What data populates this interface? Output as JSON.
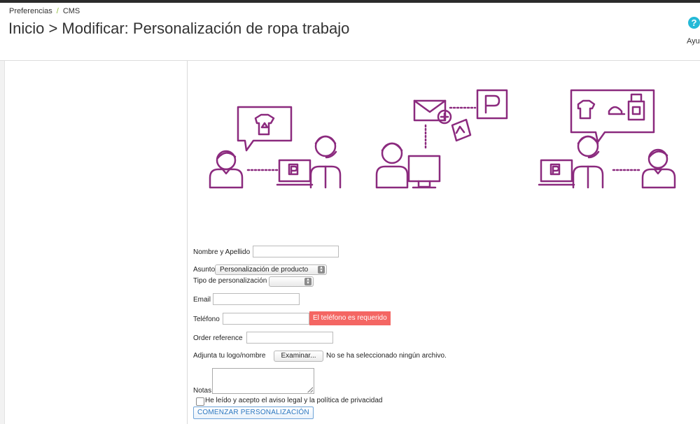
{
  "breadcrumb": {
    "items": [
      "Preferencias",
      "CMS"
    ],
    "separator": "/"
  },
  "page": {
    "title": "Inicio > Modificar: Personalización de ropa trabajo"
  },
  "help": {
    "label": "Ayu",
    "icon": "question-circle-icon"
  },
  "form": {
    "name_label": "Nombre y Apellido",
    "name_value": "",
    "subject_label": "Asunto",
    "subject_selected": "Personalización de producto",
    "type_label": "Tipo de personalización",
    "type_selected": "",
    "email_label": "Email",
    "email_value": "",
    "phone_label": "Teléfono",
    "phone_value": "",
    "phone_error": "El teléfono es requerido",
    "order_label": "Order reference",
    "order_value": "",
    "logo_label": "Adjunta tu logo/nombre",
    "file_button": "Examinar...",
    "file_status": "No se ha seleccionado ningún archivo.",
    "notes_label": "Notas",
    "notes_value": "",
    "privacy_label": "He leído y acepto el aviso legal y la política de privacidad",
    "privacy_checked": false,
    "submit_label": "COMENZAR PERSONALIZACIÓN"
  },
  "colors": {
    "illustration": "#8b2a7e",
    "error": "#f46663",
    "accent": "#25b9d7"
  }
}
